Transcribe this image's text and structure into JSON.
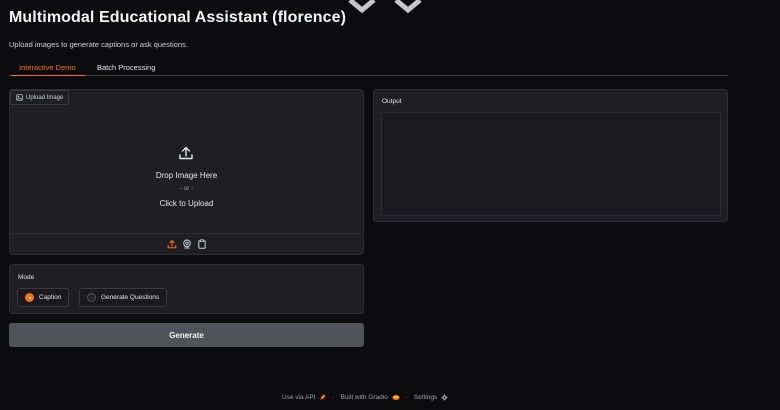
{
  "header": {
    "title": "Multimodal Educational Assistant (florence)",
    "subtitle": "Upload images to generate captions or ask questions."
  },
  "tabs": [
    {
      "label": "Interactive Demo",
      "active": true
    },
    {
      "label": "Batch Processing",
      "active": false
    }
  ],
  "upload": {
    "tag_label": "Upload Image",
    "drop_text": "Drop Image Here",
    "or_text": "- or -",
    "click_text": "Click to Upload",
    "sources": [
      "upload-icon",
      "webcam-icon",
      "clipboard-icon"
    ]
  },
  "output": {
    "label": "Output",
    "value": ""
  },
  "mode": {
    "label": "Mode",
    "options": [
      "Caption",
      "Generate Questions"
    ],
    "selected": "Caption"
  },
  "generate_button": {
    "label": "Generate"
  },
  "footer": {
    "api_label": "Use via API",
    "separator": "·",
    "built_label": "Built with Gradio",
    "settings_label": "Settings"
  },
  "colors": {
    "accent": "#f97316",
    "background": "#0c0c0e",
    "panel": "#1f1f23",
    "button": "#52525b"
  }
}
